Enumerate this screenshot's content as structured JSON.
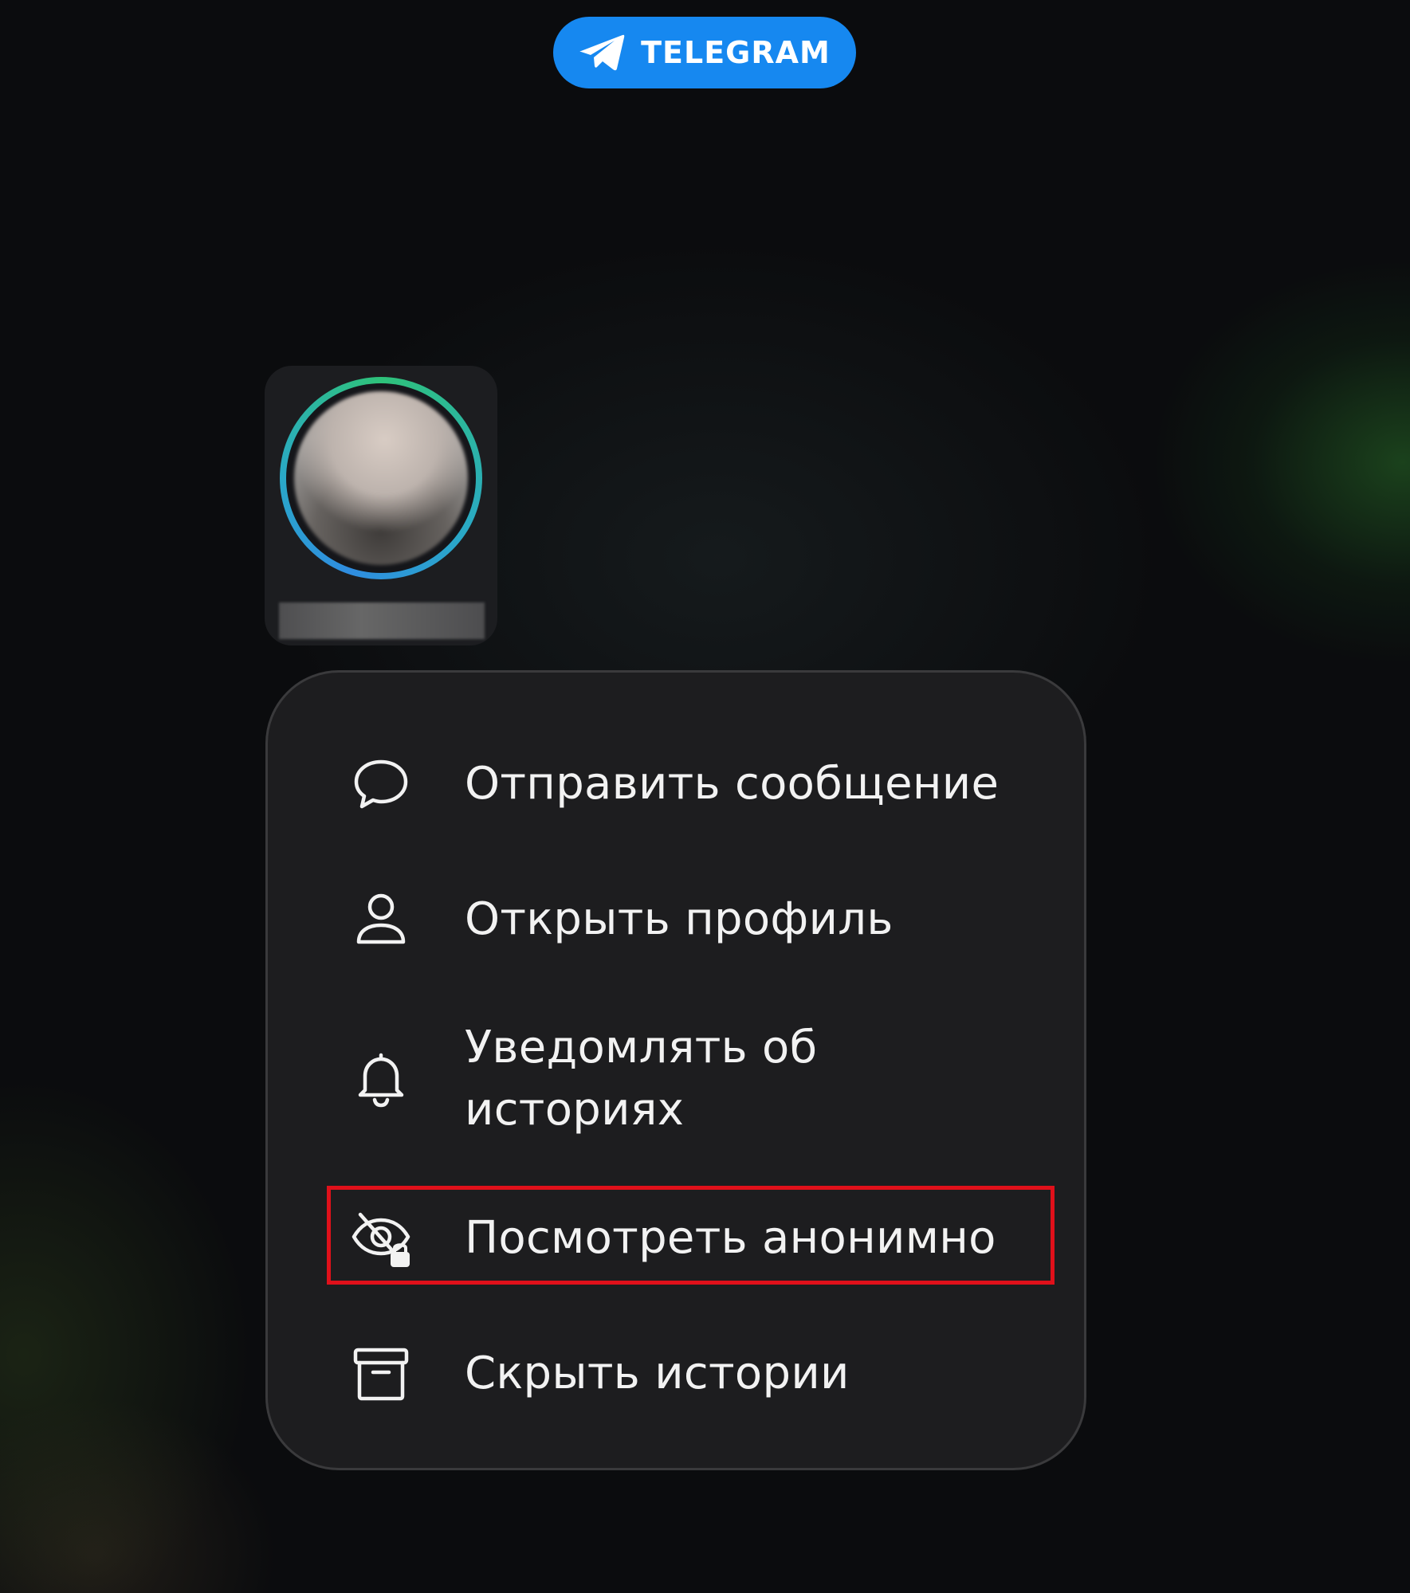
{
  "badge": {
    "label": "TELEGRAM",
    "color": "#1688f0",
    "icon": "telegram-paper-plane-icon"
  },
  "story": {
    "ring_colors": [
      "#2ec27a",
      "#2f8de0"
    ]
  },
  "menu": {
    "items": [
      {
        "icon": "chat-bubble-icon",
        "label": "Отправить сообщение"
      },
      {
        "icon": "person-icon",
        "label": "Открыть профиль"
      },
      {
        "icon": "bell-icon",
        "label": "Уведомлять об\nисториях"
      },
      {
        "icon": "eye-slash-lock-icon",
        "label": "Посмотреть анонимно"
      },
      {
        "icon": "archive-box-icon",
        "label": "Скрыть истории"
      }
    ]
  },
  "highlight": {
    "color": "#e0101a"
  }
}
